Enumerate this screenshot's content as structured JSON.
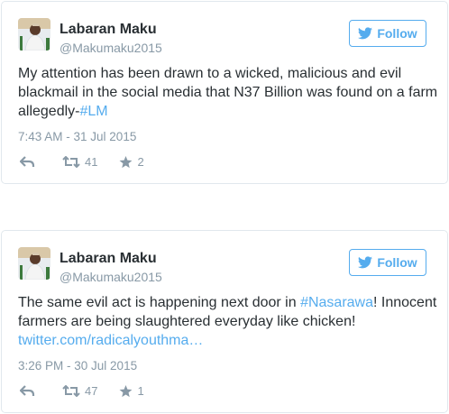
{
  "tweets": [
    {
      "name": "Labaran Maku",
      "handle": "@Makumaku2015",
      "follow_label": "Follow",
      "text_plain": "My attention has been drawn to a wicked, malicious and evil blackmail in the social media that N37 Billion was found on a farm allegedly-",
      "text_hashtag": "#LM",
      "timestamp": "7:43 AM - 31 Jul 2015",
      "retweets": "41",
      "favorites": "2"
    },
    {
      "name": "Labaran Maku",
      "handle": "@Makumaku2015",
      "follow_label": "Follow",
      "text_before": "The same evil act is happening next door in ",
      "text_hashtag": "#Nasarawa",
      "text_after": "! Innocent farmers are being slaughtered everyday like chicken! ",
      "text_link": "twitter.com/radicalyouthma…",
      "timestamp": "3:26 PM - 30 Jul 2015",
      "retweets": "47",
      "favorites": "1"
    }
  ],
  "colors": {
    "accent": "#55acee",
    "meta": "#8899a6",
    "text": "#292f33",
    "border": "#e1e8ed"
  },
  "icons": [
    "avatar-photo",
    "twitter-bird-icon",
    "reply-icon",
    "retweet-icon",
    "favorite-star-icon"
  ]
}
